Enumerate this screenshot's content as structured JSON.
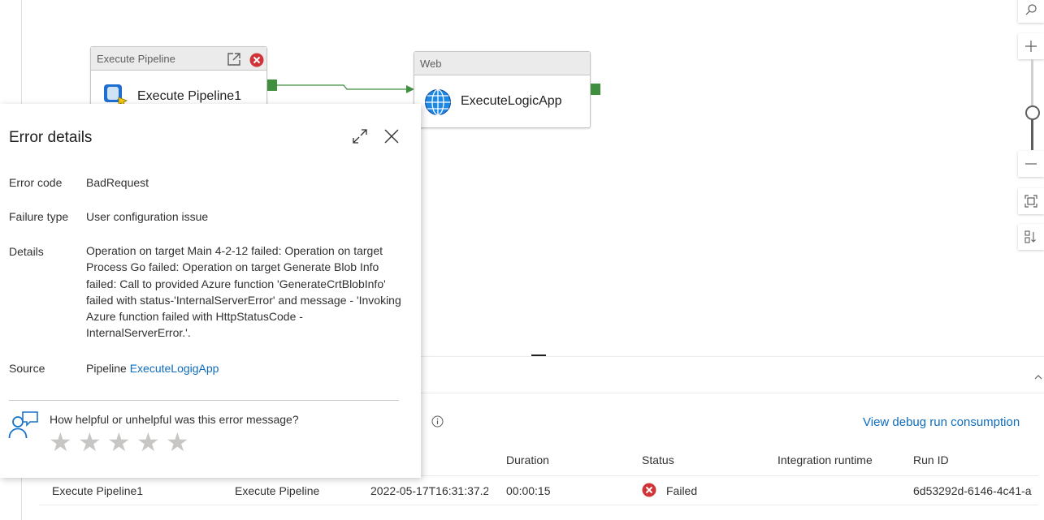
{
  "canvas": {
    "node1": {
      "type_label": "Execute Pipeline",
      "name": "Execute Pipeline1"
    },
    "node2": {
      "type_label": "Web",
      "name": "ExecuteLogicApp"
    }
  },
  "error_flyout": {
    "title": "Error details",
    "error_code_label": "Error code",
    "error_code_value": "BadRequest",
    "failure_type_label": "Failure type",
    "failure_type_value": "User configuration issue",
    "details_label": "Details",
    "details_value": "Operation on target Main 4-2-12 failed: Operation on target Process Go failed: Operation on target Generate Blob Info failed: Call to provided Azure function 'GenerateCrtBlobInfo' failed with status-'InternalServerError' and message - 'Invoking Azure function failed with HttpStatusCode - InternalServerError.'.",
    "source_label": "Source",
    "source_prefix": "Pipeline",
    "source_link": "ExecuteLogigApp",
    "feedback_question": "How helpful or unhelpful was this error message?",
    "stars": [
      "★",
      "★",
      "★",
      "★",
      "★"
    ]
  },
  "output_panel": {
    "view_consumption_link": "View debug run consumption",
    "columns": [
      "Duration",
      "Status",
      "Integration runtime",
      "Run ID"
    ],
    "rows": [
      {
        "activity_name": "Execute Pipeline1",
        "activity_type": "Execute Pipeline",
        "run_start": "2022-05-17T16:31:37.2",
        "duration": "00:00:15",
        "status": "Failed",
        "integration_runtime": "",
        "run_id": "6d53292d-6146-4c41-a"
      }
    ]
  },
  "colors": {
    "accent": "#0f6cbd",
    "success_port": "#3f8f3f",
    "error": "#d13438",
    "node_header": "#ebebeb"
  }
}
